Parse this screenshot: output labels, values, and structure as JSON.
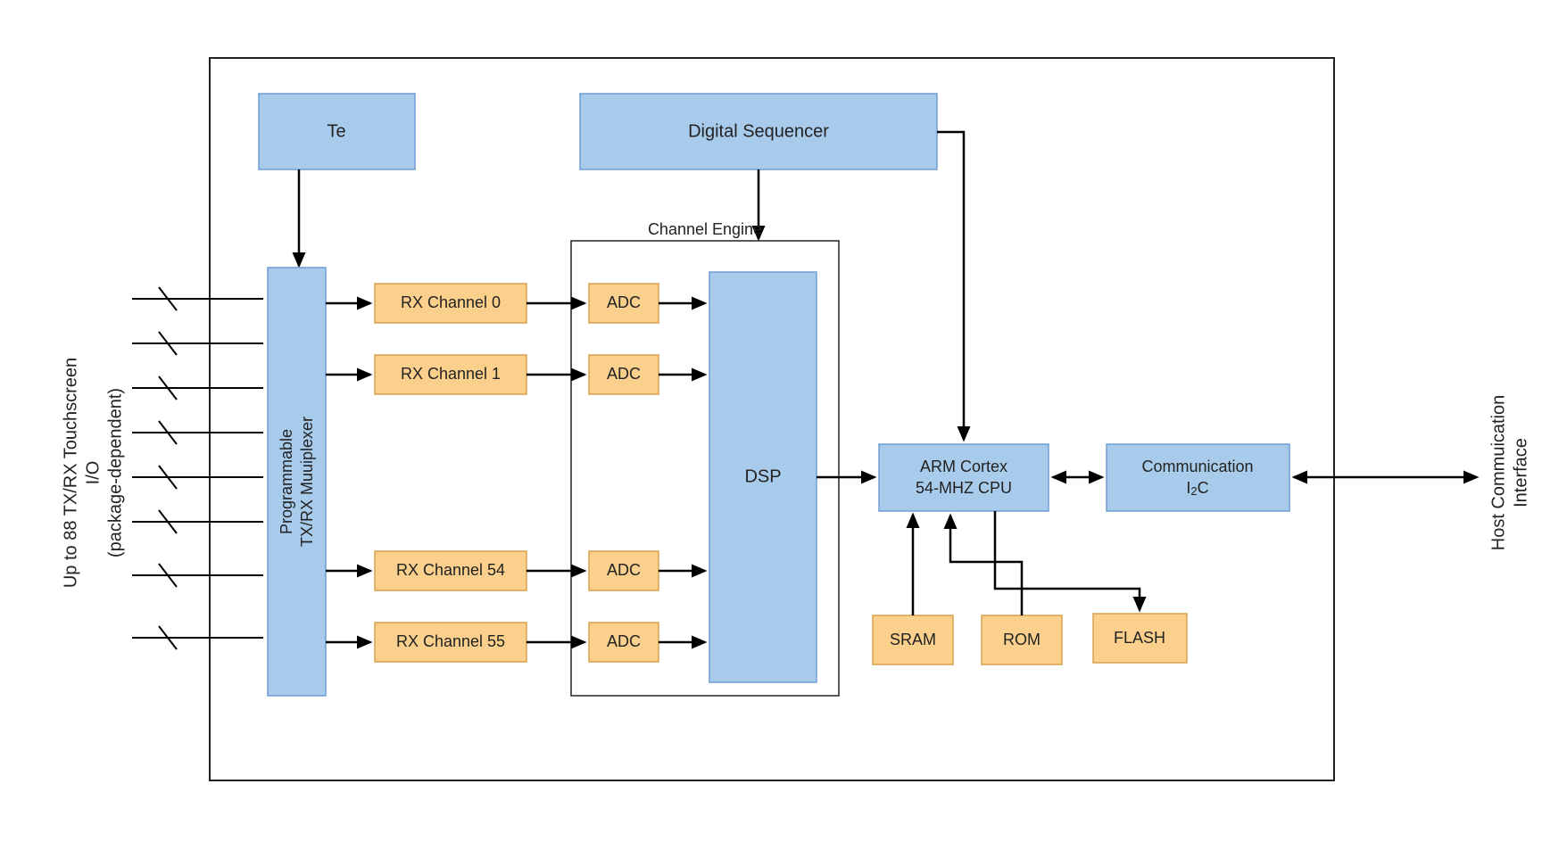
{
  "io_label": {
    "line1": "Up to 88 TX/RX Touchscreen",
    "line2": "I/O",
    "line3": "(package-dependent)"
  },
  "host_label": {
    "line1": "Host Commuication",
    "line2": "Interface"
  },
  "blocks": {
    "te": "Te",
    "digital_sequencer": "Digital Sequencer",
    "mux_line1": "Programmable",
    "mux_line2": "TX/RX Muuiplexer",
    "channel_engine": "Channel Engine",
    "dsp": "DSP",
    "arm_line1": "ARM Cortex",
    "arm_line2": "54-MHZ CPU",
    "comm_line1": "Communication",
    "comm_sub": "2",
    "comm_line2_pre": "I",
    "comm_line2_post": "C",
    "sram": "SRAM",
    "rom": "ROM",
    "flash": "FLASH"
  },
  "rx_channels": [
    {
      "name": "RX Channel 0",
      "adc": "ADC"
    },
    {
      "name": "RX Channel 1",
      "adc": "ADC"
    },
    {
      "name": "RX Channel 54",
      "adc": "ADC"
    },
    {
      "name": "RX Channel 55",
      "adc": "ADC"
    }
  ]
}
